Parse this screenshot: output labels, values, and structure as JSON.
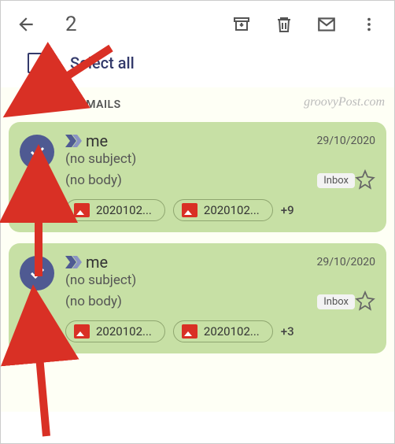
{
  "toolbar": {
    "selected_count": "2"
  },
  "select_all_label": "Select all",
  "watermark": "groovyPost.com",
  "section_title": "RESULTS IN EMAILS",
  "emails": [
    {
      "sender": "me",
      "date": "29/10/2020",
      "subject": "(no subject)",
      "body": "(no body)",
      "label": "Inbox",
      "attachments": [
        "2020102...",
        "2020102..."
      ],
      "more": "+9"
    },
    {
      "sender": "me",
      "date": "29/10/2020",
      "subject": "(no subject)",
      "body": "(no body)",
      "label": "Inbox",
      "attachments": [
        "2020102...",
        "2020102..."
      ],
      "more": "+3"
    }
  ]
}
